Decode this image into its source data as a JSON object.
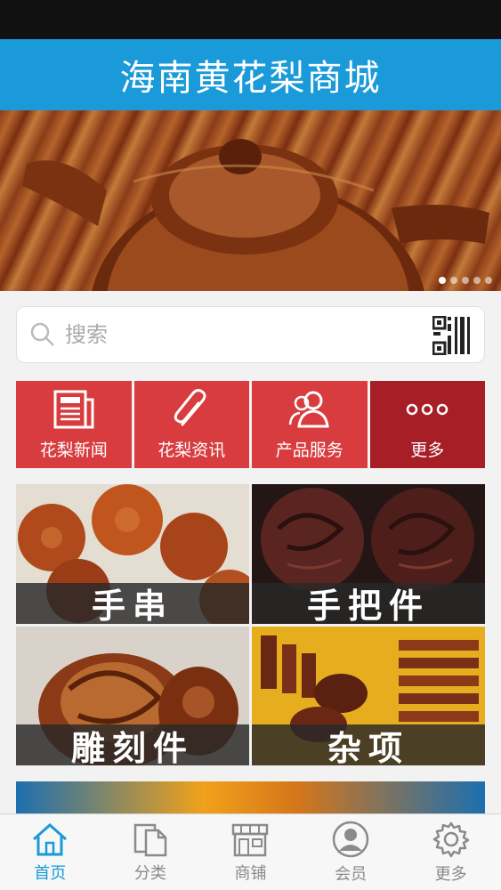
{
  "app": {
    "title": "海南黄花梨商城"
  },
  "banner": {
    "dots": 5,
    "active_dot": 0
  },
  "search": {
    "placeholder": "搜索"
  },
  "quick_links": [
    {
      "label": "花梨新闻",
      "icon": "newspaper-icon"
    },
    {
      "label": "花梨资讯",
      "icon": "paperclip-icon"
    },
    {
      "label": "产品服务",
      "icon": "users-icon"
    },
    {
      "label": "更多",
      "icon": "more-dots-icon"
    }
  ],
  "categories": [
    {
      "label": "手串"
    },
    {
      "label": "手把件"
    },
    {
      "label": "雕刻件"
    },
    {
      "label": "杂项"
    }
  ],
  "tabbar": [
    {
      "label": "首页",
      "icon": "home-icon",
      "active": true
    },
    {
      "label": "分类",
      "icon": "documents-icon",
      "active": false
    },
    {
      "label": "商铺",
      "icon": "storefront-icon",
      "active": false
    },
    {
      "label": "会员",
      "icon": "user-icon",
      "active": false
    },
    {
      "label": "更多",
      "icon": "gear-icon",
      "active": false
    }
  ],
  "colors": {
    "header": "#1a9ad8",
    "quick_red": "#d83c3f",
    "quick_dark_red": "#a71e26",
    "tab_active": "#1a9ad8"
  }
}
